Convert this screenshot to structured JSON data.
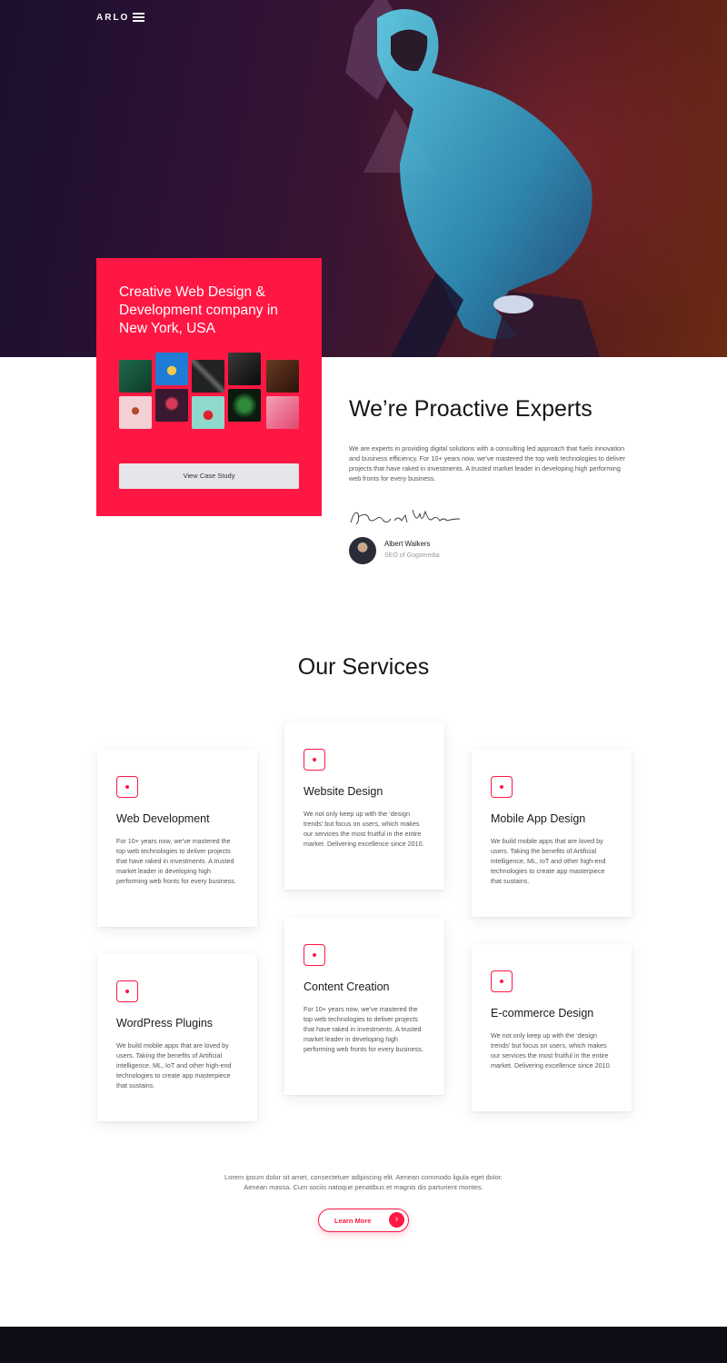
{
  "nav": {
    "logo": "ARLO",
    "menu_icon": "hamburger-menu-icon"
  },
  "hero_card": {
    "title": "Creative Web Design & Development company in New York, USA",
    "button_label": "View Case Study"
  },
  "about": {
    "title": "We’re Proactive Experts",
    "text": "We are experts in providing digital solutions with a consulting led approach that fuels innovation and business efficiency. For 10+ years now, we’ve mastered the top web technologies to deliver projects that have raked in investments. A trusted market leader in developing high performing web fronts for every business.",
    "author_name": "Albert Walkers",
    "author_role": "SEO of Gogomedia"
  },
  "services": {
    "title": "Our Services",
    "items": [
      {
        "title": "Web Development",
        "text": "For 10+ years now, we’ve mastered the top web technologies to deliver projects that have raked in investments. A trusted market leader in developing high performing web fronts for every business."
      },
      {
        "title": "Website Design",
        "text": "We not only keep up with the ‘design trends’ but focus on users, which makes our services the most fruitful in the entire market. Delivering excellence since 2010."
      },
      {
        "title": "Mobile App Design",
        "text": "We build mobile apps that are loved by users. Taking the benefits of Artificial intelligence, ML, IoT and other high-end technologies to create app masterpiece that sustains."
      },
      {
        "title": "WordPress Plugins",
        "text": "We build mobile apps that are loved by users. Taking the benefits of Artificial intelligence, ML, IoT and other high-end technologies to create app masterpiece that sustains."
      },
      {
        "title": "Content Creation",
        "text": "For 10+ years now, we’ve mastered the top web technologies to deliver projects that have raked in investments. A trusted market leader in developing high performing web fronts for every business."
      },
      {
        "title": "E-commerce Design",
        "text": "We not only keep up with the ‘design trends’ but focus on users, which makes our services the most fruitful in the entire market. Delivering excellence since 2010."
      }
    ]
  },
  "cta": {
    "text_line1": "Lorem ipsum dolor sit amet, consectetuer adipiscing elit. Aenean commodo ligula eget dolor.",
    "text_line2": "Aenean massa. Cum sociis natoque penatibus et magnis dis parturient montes.",
    "button_label": "Learn More",
    "button_icon": "chevron-right-icon"
  },
  "colors": {
    "accent": "#ff1744",
    "footer": "#0e0e16",
    "hero_dark": "#1b0f2e",
    "hero_warm": "#6a2a14"
  }
}
